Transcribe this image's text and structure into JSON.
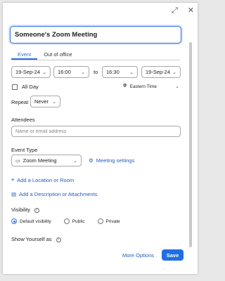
{
  "header": {
    "expand_icon": "expand-icon",
    "close_icon": "close-icon"
  },
  "title_input": {
    "value": "Someone's Zoom Meeting"
  },
  "tabs": [
    {
      "label": "Event",
      "active": true
    },
    {
      "label": "Out of office",
      "active": false
    }
  ],
  "datetime": {
    "start_date": "19-Sep-24",
    "start_time": "16:00",
    "to_label": "to",
    "end_time": "16:30",
    "end_date": "19-Sep-24"
  },
  "all_day": {
    "label": "All Day",
    "checked": false
  },
  "timezone": {
    "label": "Eastern Time"
  },
  "repeat": {
    "label": "Repeat",
    "value": "Never"
  },
  "attendees": {
    "label": "Attendees",
    "placeholder": "Name or email address"
  },
  "event_type": {
    "label": "Event Type",
    "value": "Zoom Meeting",
    "settings_link": "Meeting settings"
  },
  "links": {
    "add_location": "Add a Location or Room",
    "add_description": "Add a Description or Attachments"
  },
  "visibility": {
    "label": "Visibility",
    "options": [
      {
        "label": "Default visibility",
        "selected": true
      },
      {
        "label": "Public",
        "selected": false
      },
      {
        "label": "Private",
        "selected": false
      }
    ]
  },
  "show_yourself": {
    "label": "Show Yourself as"
  },
  "footer": {
    "more_options": "More Options",
    "save": "Save"
  },
  "colors": {
    "accent": "#1f6fe0",
    "link": "#1f5fc0"
  }
}
